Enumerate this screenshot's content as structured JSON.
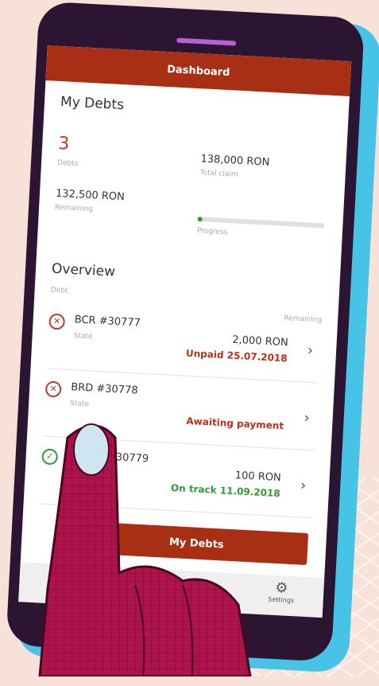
{
  "app": {
    "title": "Dashboard"
  },
  "summary": {
    "heading": "My Debts",
    "debts_count": "3",
    "debts_label": "Debts",
    "total_claim_value": "138,000 RON",
    "total_claim_label": "Total claim",
    "remaining_value": "132,500 RON",
    "remaining_label": "Remaining",
    "progress_label": "Progress",
    "progress_fraction": 0.04
  },
  "overview": {
    "heading": "Overview",
    "col_debt": "Debt",
    "col_remaining": "Remaining",
    "rows": [
      {
        "title": "BCR #30777",
        "state_label": "State",
        "amount": "2,000 RON",
        "status": "Unpaid 25.07.2018",
        "status_kind": "bad",
        "icon": "x-circle-icon"
      },
      {
        "title": "BRD #30778",
        "state_label": "State",
        "amount": "",
        "status": "Awaiting payment",
        "status_kind": "bad",
        "icon": "x-circle-icon"
      },
      {
        "title": "e #30779",
        "state_label": "",
        "amount": "100 RON",
        "status": "On track 11.09.2018",
        "status_kind": "good",
        "icon": "check-circle-icon"
      }
    ]
  },
  "cta": {
    "label": "My Debts"
  },
  "tabbar": {
    "items": [
      {
        "label": "",
        "icon": "inbox-icon"
      },
      {
        "label": "Settings",
        "icon": "gear-icon"
      }
    ]
  },
  "colors": {
    "primary": "#a92f14",
    "good": "#2e9b3a",
    "bad": "#b6301a",
    "device": "#2c1433",
    "accent": "#47c3e8",
    "background": "#f8e1d8",
    "hand": "#b0124b"
  }
}
